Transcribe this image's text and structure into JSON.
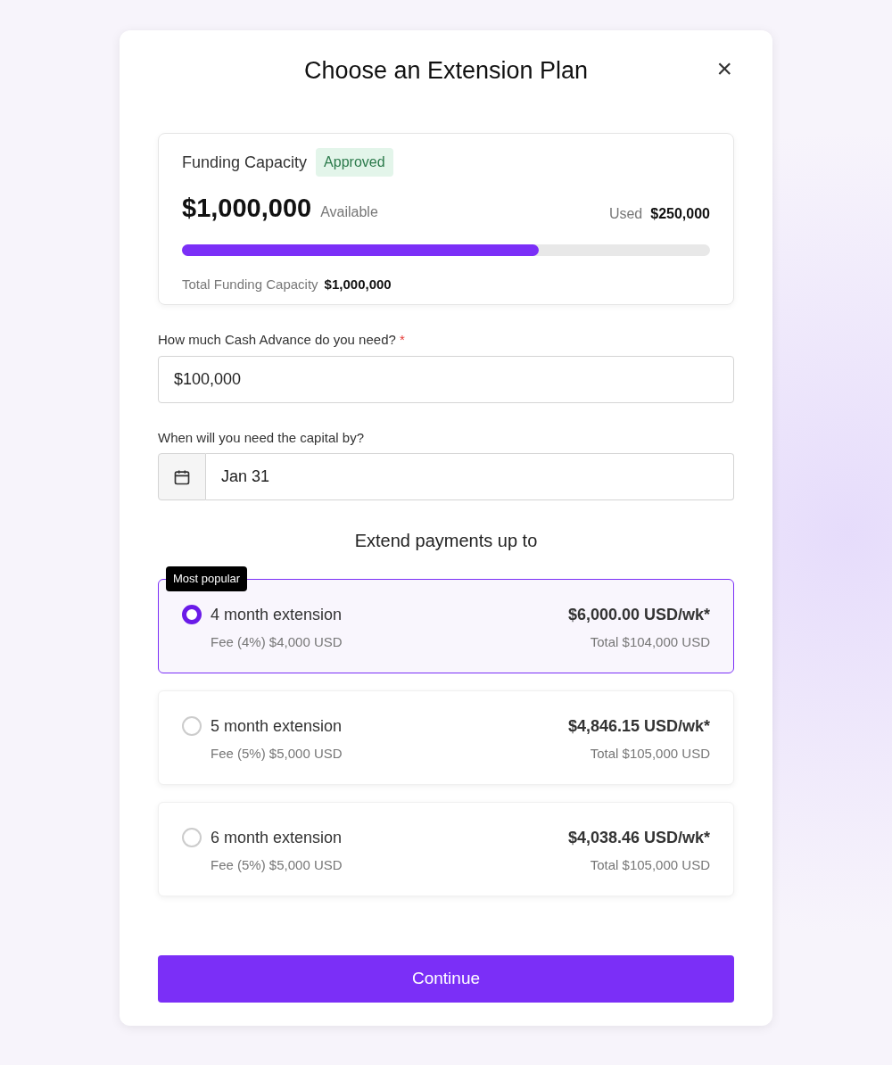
{
  "dialog": {
    "title": "Choose an Extension Plan",
    "close": "×"
  },
  "capacity": {
    "title": "Funding Capacity",
    "status": "Approved",
    "available_amount": "$1,000,000",
    "available_label": "Available",
    "used_label": "Used",
    "used_amount": "$250,000",
    "level": 0.675,
    "total_label": "Total Funding Capacity",
    "total_amount": "$1,000,000"
  },
  "amount_field": {
    "label": "How much Cash Advance do you need?",
    "required_mark": "*",
    "value": "$100,000"
  },
  "date_field": {
    "label": "When will you need the capital by?",
    "value": "Jan 31"
  },
  "plans_title": "Extend payments up to",
  "plans": [
    {
      "name": "4 month extension",
      "fee": "Fee (4%) $4,000 USD",
      "rate": "$6,000.00 USD/wk*",
      "total": "Total $104,000 USD",
      "selected": true,
      "badge": "Most popular"
    },
    {
      "name": "5 month extension",
      "fee": "Fee (5%) $5,000 USD",
      "rate": "$4,846.15 USD/wk*",
      "total": "Total $105,000 USD",
      "selected": false
    },
    {
      "name": "6 month extension",
      "fee": "Fee (5%) $5,000 USD",
      "rate": "$4,038.46 USD/wk*",
      "total": "Total $105,000 USD",
      "selected": false
    }
  ],
  "continue_button": "Continue"
}
